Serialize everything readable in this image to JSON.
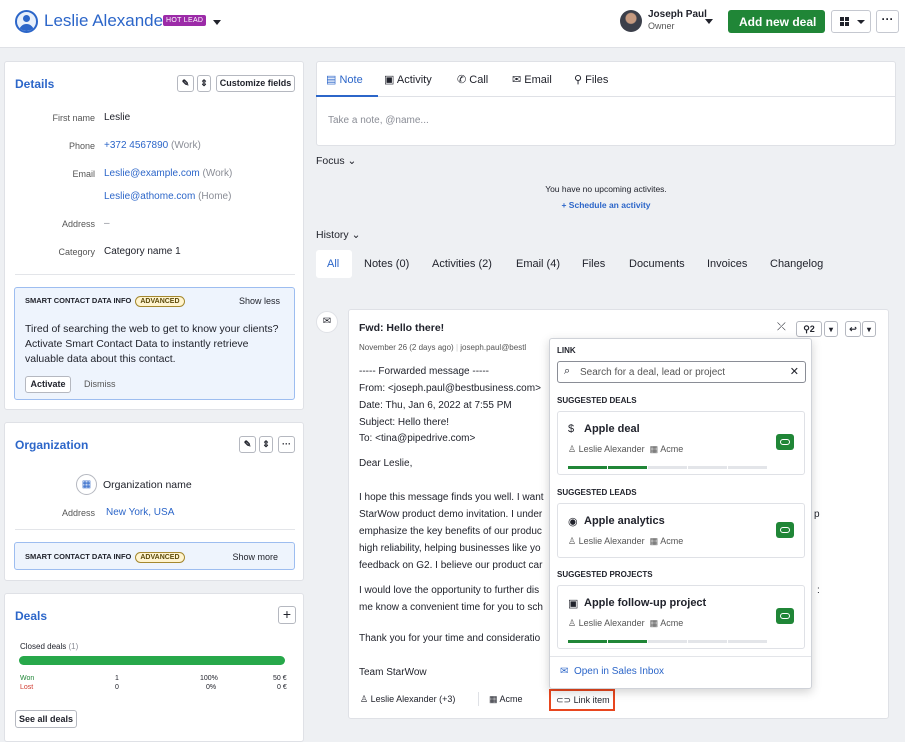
{
  "header": {
    "name": "Leslie Alexander",
    "badge": "HOT LEAD",
    "owner_name": "Joseph Paul",
    "owner_role": "Owner",
    "add_deal": "Add new deal",
    "more": "···"
  },
  "details": {
    "title": "Details",
    "customize": "Customize fields",
    "fields": [
      {
        "label": "First name",
        "value": "Leslie"
      },
      {
        "label": "Phone",
        "value": "+372 4567890",
        "note": "(Work)"
      },
      {
        "label": "Email",
        "value": "Leslie@example.com",
        "note": "(Work)"
      },
      {
        "label": "",
        "value": "Leslie@athome.com",
        "note": "(Home)"
      },
      {
        "label": "Address",
        "value": "–"
      },
      {
        "label": "Category",
        "value": "Category name 1"
      }
    ],
    "smart_title": "SMART CONTACT DATA INFO",
    "smart_badge": "ADVANCED",
    "show_less": "Show less",
    "smart_text": "Tired of searching the web to get to know your clients? Activate Smart Contact Data to instantly retrieve valuable data about this contact.",
    "activate": "Activate",
    "dismiss": "Dismiss"
  },
  "organization": {
    "title": "Organization",
    "org_name": "Organization name",
    "address_label": "Address",
    "address": "New York, USA",
    "smart_title": "SMART CONTACT DATA INFO",
    "smart_badge": "ADVANCED",
    "show_more": "Show more"
  },
  "deals": {
    "title": "Deals",
    "closed": "Closed deals",
    "closed_count": "(1)",
    "won": "Won",
    "won_count": "1",
    "won_pct": "100%",
    "won_amt": "50 €",
    "lost": "Lost",
    "lost_count": "0",
    "lost_pct": "0%",
    "lost_amt": "0 €",
    "see_all": "See all deals"
  },
  "compose": {
    "tabs": [
      "Note",
      "Activity",
      "Call",
      "Email",
      "Files"
    ],
    "placeholder": "Take a note, @name..."
  },
  "focus": {
    "title": "Focus",
    "empty": "You have no upcoming activites.",
    "schedule": "+ Schedule an activity"
  },
  "history": {
    "title": "History",
    "tabs": [
      "All",
      "Notes (0)",
      "Activities (2)",
      "Email (4)",
      "Files",
      "Documents",
      "Invoices",
      "Changelog"
    ]
  },
  "email": {
    "subject": "Fwd: Hello there!",
    "meta": "November 26 (2 days ago)",
    "from_addr": "joseph.paul@bestl",
    "attach_count": "2",
    "lines": [
      "----- Forwarded message -----",
      "From: <joseph.paul@bestbusiness.com>",
      "Date: Thu, Jan 6, 2022 at 7:55 PM",
      "Subject: Hello there!",
      "To: <tina@pipedrive.com>",
      "Dear Leslie,",
      "I hope this message finds you well. I want",
      "StarWow product demo invitation. I under",
      "emphasize the key benefits of our produc",
      "high reliability, helping businesses like yo",
      "feedback on G2. I believe our product car",
      "I would love the opportunity to further dis",
      "me know a convenient time for you to sch",
      "Thank you for your time and consideratio",
      "Team StarWow"
    ],
    "trailing_p": "p",
    "trailing_colon": ":",
    "person": "Leslie Alexander (+3)",
    "org": "Acme",
    "link_item": "Link item"
  },
  "link_popover": {
    "title": "LINK",
    "search_placeholder": "Search for a deal, lead or project",
    "deals_head": "SUGGESTED DEALS",
    "leads_head": "SUGGESTED LEADS",
    "projects_head": "SUGGESTED PROJECTS",
    "deal": {
      "title": "Apple deal",
      "person": "Leslie Alexander",
      "org": "Acme"
    },
    "lead": {
      "title": "Apple analytics",
      "person": "Leslie Alexander",
      "org": "Acme"
    },
    "project": {
      "title": "Apple follow-up project",
      "person": "Leslie Alexander",
      "org": "Acme"
    },
    "open_inbox": "Open in Sales Inbox"
  },
  "colors": {
    "accent": "#2c66c9",
    "green": "#208637",
    "badge": "#9c2ba8",
    "highlight": "#e8461e"
  }
}
